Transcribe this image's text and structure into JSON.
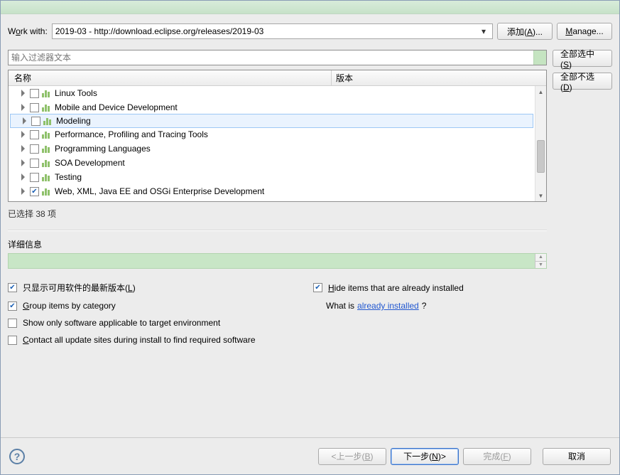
{
  "workwith": {
    "label_pre": "W",
    "label_u": "o",
    "label_post": "rk with:",
    "value": "2019-03 - http://download.eclipse.org/releases/2019-03",
    "add": "添加(A)...",
    "manage": "Manage..."
  },
  "filter": {
    "placeholder": "输入过滤器文本"
  },
  "side": {
    "select_all": "全部选中(S)",
    "deselect_all": "全部不选(D)"
  },
  "columns": {
    "name": "名称",
    "version": "版本"
  },
  "rows": [
    {
      "label": "Linux Tools",
      "checked": false,
      "selected": false
    },
    {
      "label": "Mobile and Device Development",
      "checked": false,
      "selected": false
    },
    {
      "label": "Modeling",
      "checked": false,
      "selected": true
    },
    {
      "label": "Performance, Profiling and Tracing Tools",
      "checked": false,
      "selected": false
    },
    {
      "label": "Programming Languages",
      "checked": false,
      "selected": false
    },
    {
      "label": "SOA Development",
      "checked": false,
      "selected": false
    },
    {
      "label": "Testing",
      "checked": false,
      "selected": false
    },
    {
      "label": "Web, XML, Java EE and OSGi Enterprise Development",
      "checked": true,
      "selected": false
    }
  ],
  "status": "已选择 38 项",
  "details_label": "详细信息",
  "options": {
    "latest_pre": "只显示可用软件的最新版本(",
    "latest_u": "L",
    "latest_post": ")",
    "hide_u": "H",
    "hide_post": "ide items that are already installed",
    "group_u": "G",
    "group_post": "roup items by category",
    "whatis_pre": "What is ",
    "whatis_link": "already installed",
    "whatis_post": "?",
    "target_env": "Show only software applicable to target environment",
    "contact_u": "C",
    "contact_post": "ontact all update sites during install to find required software"
  },
  "footer": {
    "back": "<上一步(B)",
    "next": "下一步(N)>",
    "finish": "完成(F)",
    "cancel": "取消"
  }
}
